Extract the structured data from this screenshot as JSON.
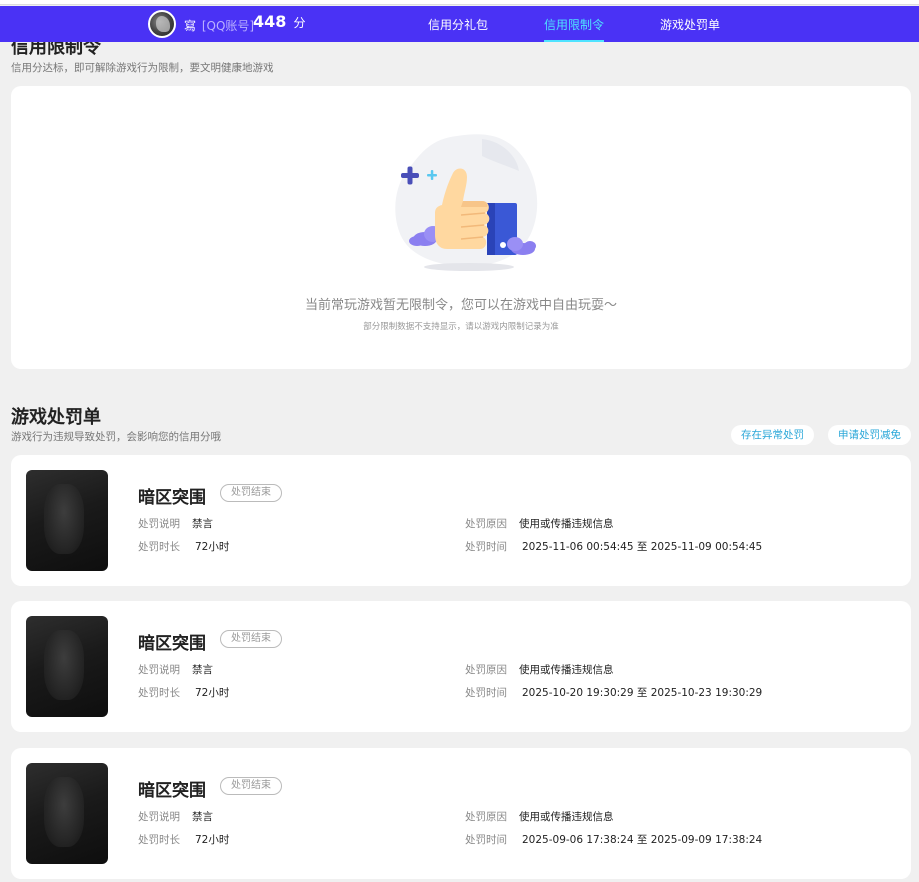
{
  "header": {
    "user_name": "寫",
    "user_tag": "[QQ账号]",
    "score_value": "448",
    "score_unit": "分",
    "tabs": [
      {
        "label": "信用分礼包",
        "active": false
      },
      {
        "label": "信用限制令",
        "active": true
      },
      {
        "label": "游戏处罚单",
        "active": false
      }
    ]
  },
  "restriction": {
    "title": "信用限制令",
    "subtitle": "信用分达标，即可解除游戏行为限制，要文明健康地游戏",
    "empty_message": "当前常玩游戏暂无限制令，您可以在游戏中自由玩耍～",
    "empty_hint": "部分限制数据不支持显示，请以游戏内限制记录为准",
    "illustration_icon": "thumbs-up-icon"
  },
  "penalties": {
    "title": "游戏处罚单",
    "subtitle": "游戏行为违规导致处罚，会影响您的信用分哦",
    "buttons": {
      "abnormal": "存在异常处罚",
      "appeal": "申请处罚减免"
    },
    "labels": {
      "description": "处罚说明",
      "duration": "处罚时长",
      "reason": "处罚原因",
      "time": "处罚时间",
      "range_sep": "至"
    },
    "items": [
      {
        "game": "暗区突围",
        "status": "处罚结束",
        "description": "禁言",
        "duration": "72小时",
        "reason": "使用或传播违规信息",
        "start": "2025-11-06 00:54:45",
        "end": "2025-11-09 00:54:45"
      },
      {
        "game": "暗区突围",
        "status": "处罚结束",
        "description": "禁言",
        "duration": "72小时",
        "reason": "使用或传播违规信息",
        "start": "2025-10-20 19:30:29",
        "end": "2025-10-23 19:30:29"
      },
      {
        "game": "暗区突围",
        "status": "处罚结束",
        "description": "禁言",
        "duration": "72小时",
        "reason": "使用或传播违规信息",
        "start": "2025-09-06 17:38:24",
        "end": "2025-09-09 17:38:24"
      }
    ]
  },
  "colors": {
    "header_bg": "#4a32f5",
    "active_tab": "#4fe3ff",
    "link_blue": "#2aa7d8",
    "page_bg": "#f0f0f0"
  }
}
